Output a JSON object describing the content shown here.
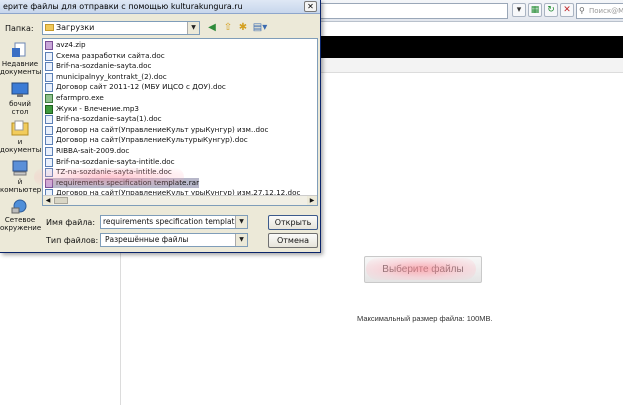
{
  "browser": {
    "search_placeholder": "Поиск@Mail"
  },
  "page": {
    "choose_button": "Выберите файлы",
    "max_size_text": "Максимальный размер файла: 100MB."
  },
  "dialog": {
    "title": "ерите файлы для отправки с помощью kulturakungura.ru",
    "close_label": "✕",
    "folder_label": "Папка:",
    "folder_value": "Загрузки",
    "places": [
      {
        "label": "Недавние документы",
        "icon": "recent-documents-icon"
      },
      {
        "label": "бочий стол",
        "icon": "desktop-icon"
      },
      {
        "label": "и документы",
        "icon": "my-documents-icon"
      },
      {
        "label": "й компьютер",
        "icon": "my-computer-icon"
      },
      {
        "label": "Сетевое окружение",
        "icon": "network-icon"
      }
    ],
    "files": [
      "avz4.zip",
      "Схема разработки сайта.doc",
      "Brif-na-sozdanie-sayta.doc",
      "municipalnyy_kontrakt_(2).doc",
      "Договор сайт 2011-12 (МБУ ИЦСО с ДОУ).doc",
      "efarmpro.exe",
      "Жуки - Влечение.mp3",
      "Brif-na-sozdanie-sayta(1).doc",
      "Договор на сайт(УправлениеКульт урыКунгур) изм..doc",
      "Договор на сайт(УправлениеКультурыКунгур).doc",
      "RIBBA-sait-2009.doc",
      "Brif-na-sozdanie-sayta-intitle.doc",
      "TZ-na-sozdanie-sayta-intitle.doc",
      "requirements specification template.rar",
      "Договор на сайт(УправлениеКульт урыКунгур) изм.27.12.12.doc"
    ],
    "selected_index": 13,
    "filename_label": "Имя файла:",
    "filename_value": "requirements specification template.rar",
    "filetype_label": "Тип файлов:",
    "filetype_value": "Разрешённые файлы",
    "open_button": "Открыть",
    "cancel_button": "Отмена"
  }
}
